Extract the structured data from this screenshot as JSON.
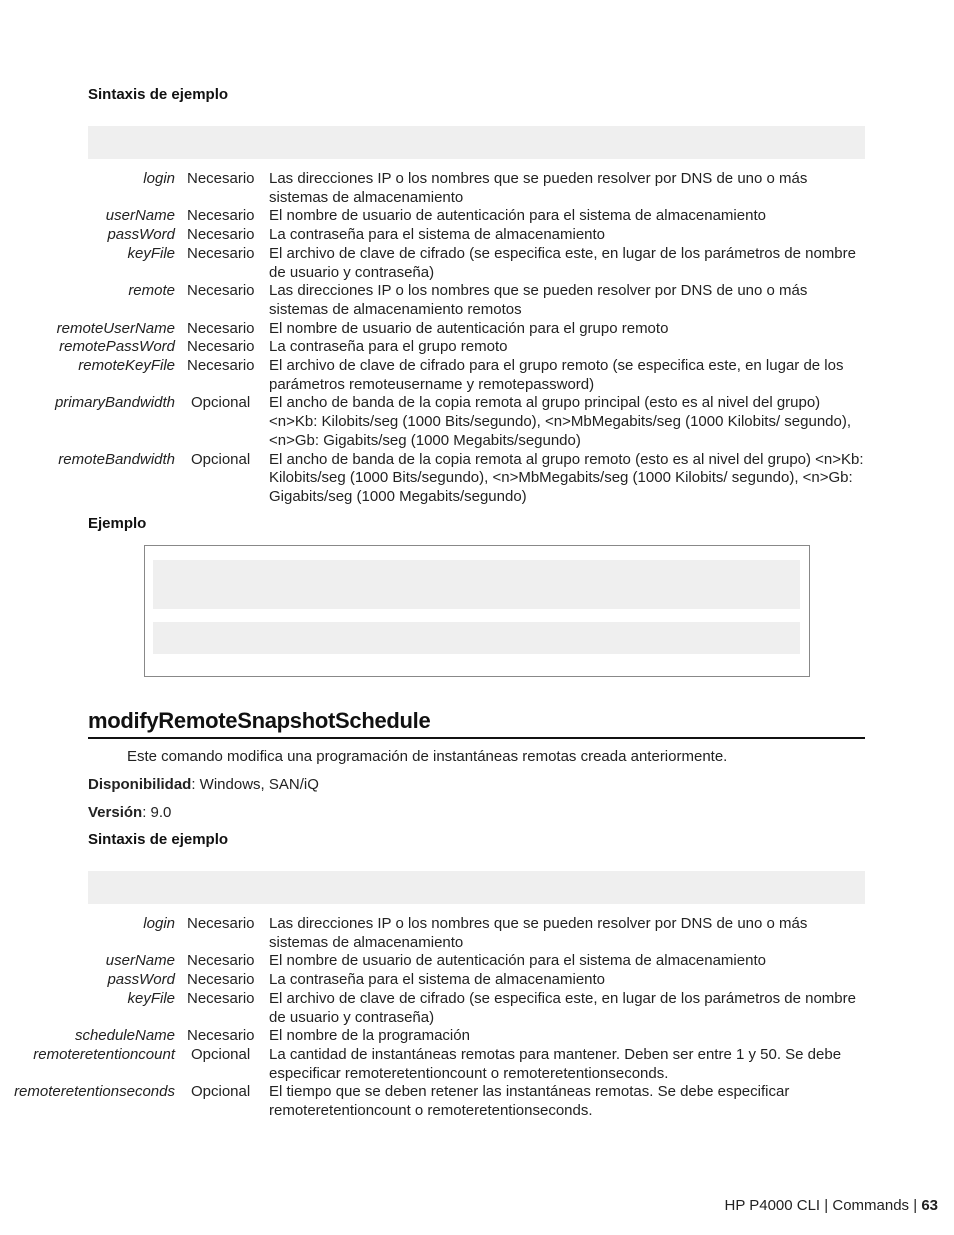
{
  "section1": {
    "syntax_heading": "Sintaxis de ejemplo",
    "params": [
      {
        "name": "login",
        "req": "Necesario",
        "desc": "Las direcciones IP o los nombres que se pueden resolver por DNS de uno o más sistemas de almacenamiento"
      },
      {
        "name": "userName",
        "req": "Necesario",
        "desc": "El nombre de usuario de autenticación para el sistema de almacenamiento"
      },
      {
        "name": "passWord",
        "req": "Necesario",
        "desc": "La contraseña para el sistema de almacenamiento"
      },
      {
        "name": "keyFile",
        "req": "Necesario",
        "desc": "El archivo de clave de cifrado (se especifica este, en lugar de los parámetros de nombre de usuario y contraseña)"
      },
      {
        "name": "remote",
        "req": "Necesario",
        "desc": "Las direcciones IP o los nombres que se pueden resolver por DNS de uno o más sistemas de almacenamiento remotos"
      },
      {
        "name": "remoteUserName",
        "req": "Necesario",
        "desc": "El nombre de usuario de autenticación para el grupo remoto"
      },
      {
        "name": "remotePassWord",
        "req": "Necesario",
        "desc": "La contraseña para el grupo remoto"
      },
      {
        "name": "remoteKeyFile",
        "req": "Necesario",
        "desc": "El archivo de clave de cifrado para el grupo remoto (se especifica este, en lugar de los parámetros remoteusername y remotepassword)"
      },
      {
        "name": "primaryBandwidth",
        "req": "Opcional",
        "desc": "El ancho de banda de la copia remota al grupo principal (esto es al nivel del grupo) <n>Kb: Kilobits/seg (1000 Bits/segundo), <n>MbMegabits/seg (1000 Kilobits/ segundo), <n>Gb: Gigabits/seg (1000 Megabits/segundo)"
      },
      {
        "name": "remoteBandwidth",
        "req": "Opcional",
        "desc": "El ancho de banda de la copia remota al grupo remoto (esto es al nivel del grupo) <n>Kb: Kilobits/seg (1000 Bits/segundo), <n>MbMegabits/seg (1000 Kilobits/ segundo), <n>Gb: Gigabits/seg (1000 Megabits/segundo)"
      }
    ],
    "example_heading": "Ejemplo"
  },
  "section2": {
    "title": "modifyRemoteSnapshotSchedule",
    "description": "Este comando modifica una programación de instantáneas remotas creada anteriormente.",
    "availability_label": "Disponibilidad",
    "availability_value": ": Windows, SAN/iQ",
    "version_label": "Versión",
    "version_value": ": 9.0",
    "syntax_heading": "Sintaxis de ejemplo",
    "params": [
      {
        "name": "login",
        "req": "Necesario",
        "desc": "Las direcciones IP o los nombres que se pueden resolver por DNS de uno o más sistemas de almacenamiento"
      },
      {
        "name": "userName",
        "req": "Necesario",
        "desc": "El nombre de usuario de autenticación para el sistema de almacenamiento"
      },
      {
        "name": "passWord",
        "req": "Necesario",
        "desc": "La contraseña para el sistema de almacenamiento"
      },
      {
        "name": "keyFile",
        "req": "Necesario",
        "desc": "El archivo de clave de cifrado (se especifica este, en lugar de los parámetros de nombre de usuario y contraseña)"
      },
      {
        "name": "scheduleName",
        "req": "Necesario",
        "desc": "El nombre de la programación"
      },
      {
        "name": "remoteretentioncount",
        "req": "Opcional",
        "desc": "La cantidad de instantáneas remotas para mantener. Deben ser entre 1 y 50. Se debe especificar remoteretentioncount o remoteretentionseconds."
      },
      {
        "name": "remoteretentionseconds",
        "req": "Opcional",
        "desc": "El tiempo que se deben retener las instantáneas remotas. Se debe especificar remoteretentioncount o remoteretentionseconds."
      }
    ]
  },
  "footer": {
    "doc": "HP P4000 CLI",
    "sep": "|",
    "chapter": "Commands",
    "page": "63"
  }
}
